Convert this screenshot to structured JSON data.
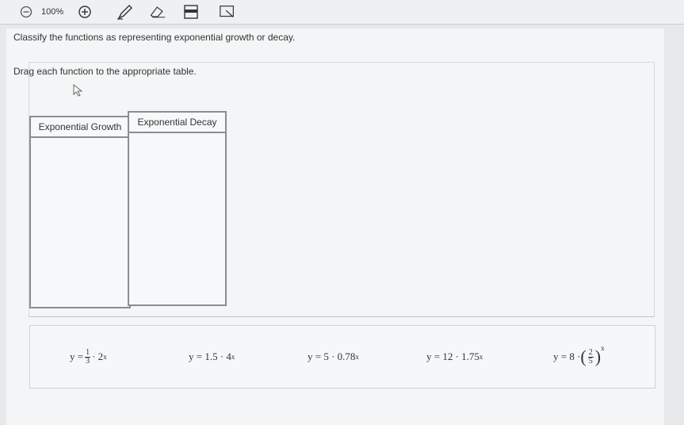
{
  "toolbar": {
    "zoom_level": "100%",
    "icons": [
      "zoom-out-icon",
      "zoom-in-icon",
      "pencil-icon",
      "eraser-icon",
      "highlighter-icon",
      "markup-icon"
    ]
  },
  "question": {
    "instruction": "Classify the functions as representing exponential growth or decay.",
    "drag_prompt": "Drag each function to the appropriate table."
  },
  "tables": {
    "growth_header": "Exponential Growth",
    "decay_header": "Exponential Decay"
  },
  "tiles": {
    "t1": {
      "lhs": "y =",
      "num": "1",
      "den": "3",
      "mid": "· 2",
      "exp": "x"
    },
    "t2": {
      "text": "y = 1.5 · 4",
      "exp": "x"
    },
    "t3": {
      "text": "y = 5 · 0.78",
      "exp": "x"
    },
    "t4": {
      "text": "y = 12 · 1.75",
      "exp": "x"
    },
    "t5": {
      "lhs": "y = 8 ·",
      "lparen": "(",
      "num": "2",
      "den": "5",
      "rparen": ")",
      "exp": "x"
    }
  },
  "colors": {
    "table_border": "#8a8d91",
    "background": "#e7e8ea"
  }
}
